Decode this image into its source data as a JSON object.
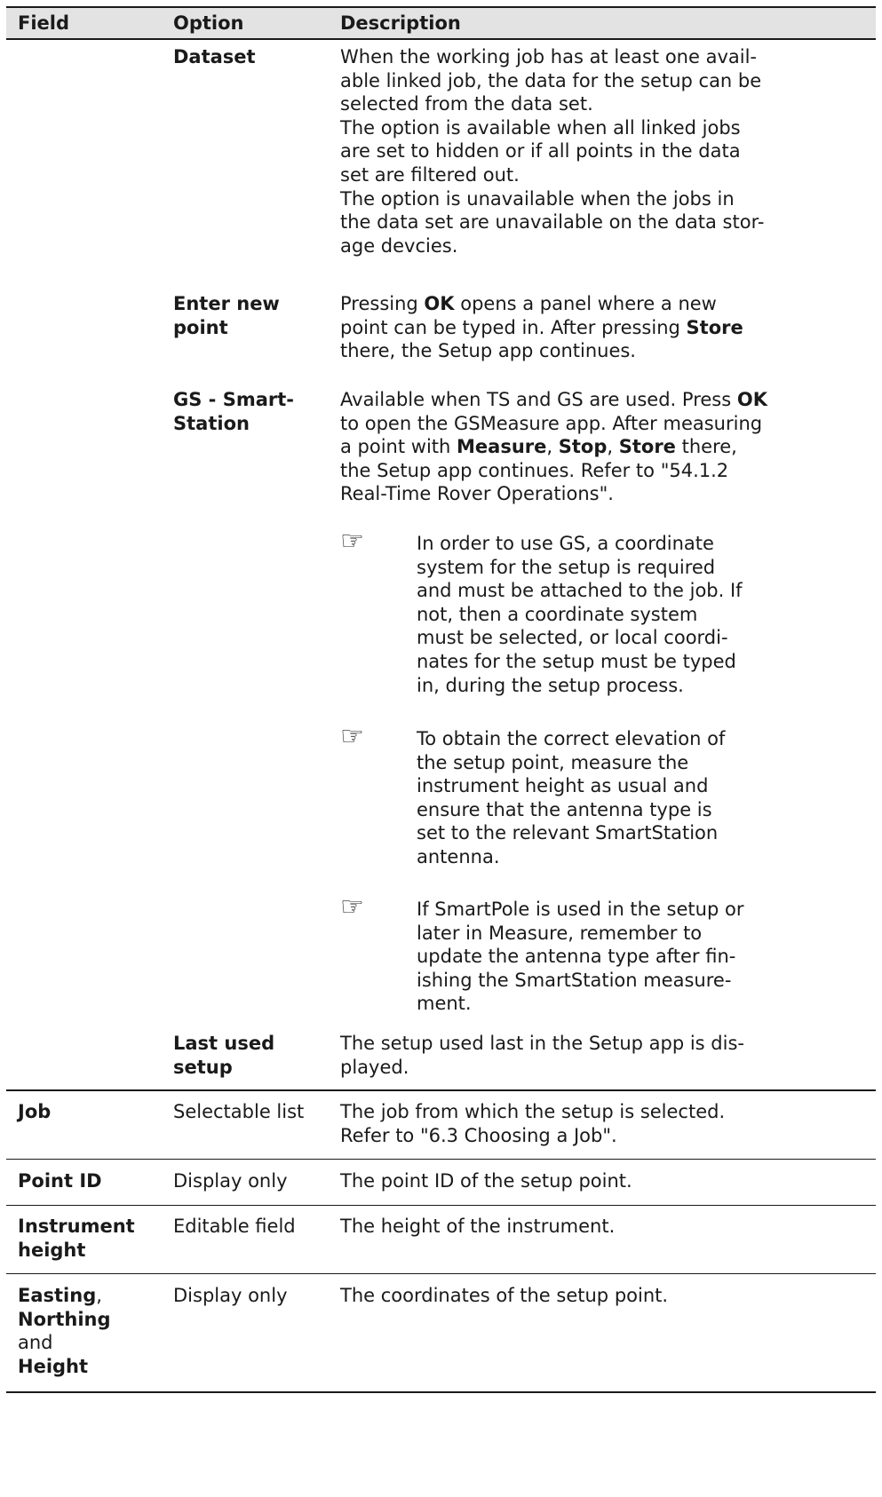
{
  "header": {
    "field": "Field",
    "option": "Option",
    "description": "Description"
  },
  "dataset": {
    "option": "Dataset",
    "lines": [
      "When the working job has at least one avail-",
      "able linked job, the data for the setup can be",
      "selected from the data set.",
      "The option is available when all linked jobs",
      "are set to hidden or if all points in the data",
      "set are filtered out.",
      "The option is unavailable when the jobs in",
      "the data set are unavailable on the data stor-",
      "age devcies."
    ]
  },
  "enter_new_point": {
    "option_line1": "Enter new",
    "option_line2": "point",
    "desc_1": "Pressing ",
    "desc_ok": "OK",
    "desc_2": " opens a panel where a new",
    "desc_3": "point can be typed in. After pressing ",
    "desc_store": "Store",
    "desc_4": "there, the Setup app continues."
  },
  "gs_smartstation": {
    "option_line1": "GS - Smart-",
    "option_line2": "Station",
    "desc_1": "Available when TS and GS are used. Press ",
    "desc_ok": "OK",
    "desc_2": "to open the GSMeasure app. After measuring",
    "desc_3": "a point with ",
    "desc_measure": "Measure",
    "desc_sep1": ", ",
    "desc_stop": "Stop",
    "desc_sep2": ", ",
    "desc_store": "Store",
    "desc_4": " there,",
    "desc_5": "the Setup app continues. Refer to \"54.1.2",
    "desc_6": "Real-Time Rover Operations\".",
    "notes": [
      {
        "icon": "☞",
        "lines": [
          "In order to use GS, a coordinate",
          "system for the setup is required",
          "and must be attached to the job. If",
          "not, then a coordinate system",
          "must be selected, or local coordi-",
          "nates for the setup must be typed",
          "in, during the setup process."
        ]
      },
      {
        "icon": "☞",
        "lines": [
          "To obtain the correct elevation of",
          "the setup point, measure the",
          "instrument height as usual and",
          "ensure that the antenna type is",
          "set to the relevant SmartStation",
          "antenna."
        ]
      },
      {
        "icon": "☞",
        "lines": [
          "If SmartPole is used in the setup or",
          "later in Measure, remember to",
          "update the antenna type after fin-",
          "ishing the SmartStation measure-",
          "ment."
        ]
      }
    ]
  },
  "last_used_setup": {
    "option_line1": "Last used",
    "option_line2": "setup",
    "lines": [
      "The setup used last in the Setup app is dis-",
      "played."
    ]
  },
  "job": {
    "field": "Job",
    "option": "Selectable list",
    "lines": [
      "The job from which the setup is selected.",
      "Refer to \"6.3 Choosing a Job\"."
    ]
  },
  "point_id": {
    "field": "Point ID",
    "option": "Display only",
    "description": "The point ID of the setup point."
  },
  "instrument_height": {
    "field_line1": "Instrument",
    "field_line2": "height",
    "option": "Editable field",
    "description": "The height of the instrument."
  },
  "coordinates": {
    "field_easting": "Easting",
    "field_comma": ",",
    "field_northing": "Northing",
    "field_and": "and",
    "field_height": "Height",
    "option": "Display only",
    "description": "The coordinates of the setup point."
  }
}
